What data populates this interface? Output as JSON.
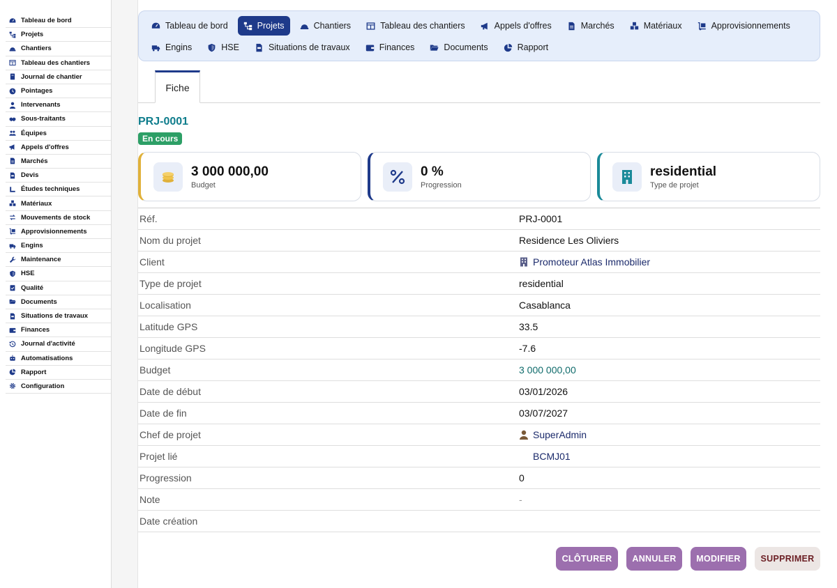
{
  "sidebar": {
    "items": [
      {
        "label": "Tableau de bord",
        "icon": "dashboard-icon"
      },
      {
        "label": "Projets",
        "icon": "sitemap-icon"
      },
      {
        "label": "Chantiers",
        "icon": "hard-hat-icon"
      },
      {
        "label": "Tableau des chantiers",
        "icon": "table-icon"
      },
      {
        "label": "Journal de chantier",
        "icon": "book-icon"
      },
      {
        "label": "Pointages",
        "icon": "clock-icon"
      },
      {
        "label": "Intervenants",
        "icon": "user-tie-icon"
      },
      {
        "label": "Sous-traitants",
        "icon": "handshake-icon"
      },
      {
        "label": "Équipes",
        "icon": "users-icon"
      },
      {
        "label": "Appels d'offres",
        "icon": "megaphone-icon"
      },
      {
        "label": "Marchés",
        "icon": "file-contract-icon"
      },
      {
        "label": "Devis",
        "icon": "file-invoice-icon"
      },
      {
        "label": "Études techniques",
        "icon": "ruler-icon"
      },
      {
        "label": "Matériaux",
        "icon": "cubes-icon"
      },
      {
        "label": "Mouvements de stock",
        "icon": "exchange-icon"
      },
      {
        "label": "Approvisionnements",
        "icon": "dolly-icon"
      },
      {
        "label": "Engins",
        "icon": "truck-icon"
      },
      {
        "label": "Maintenance",
        "icon": "wrench-icon"
      },
      {
        "label": "HSE",
        "icon": "shield-icon"
      },
      {
        "label": "Qualité",
        "icon": "clipboard-check-icon"
      },
      {
        "label": "Documents",
        "icon": "folder-open-icon"
      },
      {
        "label": "Situations de travaux",
        "icon": "file-invoice-icon"
      },
      {
        "label": "Finances",
        "icon": "wallet-icon"
      },
      {
        "label": "Journal d'activité",
        "icon": "history-icon"
      },
      {
        "label": "Automatisations",
        "icon": "robot-icon"
      },
      {
        "label": "Rapport",
        "icon": "chart-pie-icon"
      },
      {
        "label": "Configuration",
        "icon": "gear-icon"
      }
    ]
  },
  "topnav": {
    "row1": [
      {
        "label": "Tableau de bord",
        "icon": "dashboard-icon"
      },
      {
        "label": "Projets",
        "icon": "sitemap-icon",
        "active": true
      },
      {
        "label": "Chantiers",
        "icon": "hard-hat-icon"
      },
      {
        "label": "Tableau des chantiers",
        "icon": "table-icon"
      },
      {
        "label": "Appels d'offres",
        "icon": "megaphone-icon"
      },
      {
        "label": "Marchés",
        "icon": "file-contract-icon"
      },
      {
        "label": "Matériaux",
        "icon": "cubes-icon"
      },
      {
        "label": "Approvisionnements",
        "icon": "dolly-icon"
      }
    ],
    "row2": [
      {
        "label": "Engins",
        "icon": "truck-icon"
      },
      {
        "label": "HSE",
        "icon": "shield-icon"
      },
      {
        "label": "Situations de travaux",
        "icon": "file-invoice-icon"
      },
      {
        "label": "Finances",
        "icon": "wallet-icon"
      },
      {
        "label": "Documents",
        "icon": "folder-open-icon"
      },
      {
        "label": "Rapport",
        "icon": "chart-pie-icon"
      }
    ]
  },
  "tabs": {
    "fiche": "Fiche"
  },
  "header": {
    "ref": "PRJ-0001",
    "status": "En cours",
    "status_color": "#2d9f66"
  },
  "cards": {
    "budget": {
      "value": "3 000 000,00",
      "label": "Budget",
      "accent": "#e0b13a"
    },
    "progress": {
      "value": "0 %",
      "label": "Progression",
      "accent": "#1e3a8a"
    },
    "type": {
      "value": "residential",
      "label": "Type de projet",
      "accent": "#1a8a99"
    }
  },
  "details": [
    {
      "label": "Réf.",
      "value": "PRJ-0001"
    },
    {
      "label": "Nom du projet",
      "value": "Residence Les Oliviers"
    },
    {
      "label": "Client",
      "value": "Promoteur Atlas Immobilier",
      "kind": "link",
      "icon": "building-icon"
    },
    {
      "label": "Type de projet",
      "value": "residential"
    },
    {
      "label": "Localisation",
      "value": "Casablanca"
    },
    {
      "label": "Latitude GPS",
      "value": "33.5"
    },
    {
      "label": "Longitude GPS",
      "value": "-7.6"
    },
    {
      "label": "Budget",
      "value": "3 000 000,00",
      "kind": "money"
    },
    {
      "label": "Date de début",
      "value": "03/01/2026"
    },
    {
      "label": "Date de fin",
      "value": "03/07/2027"
    },
    {
      "label": "Chef de projet",
      "value": "SuperAdmin",
      "kind": "link",
      "icon": "user-icon"
    },
    {
      "label": "Projet lié",
      "value": "BCMJ01",
      "kind": "link",
      "icon": "sitemap-icon"
    },
    {
      "label": "Progression",
      "value": "0"
    },
    {
      "label": "Note",
      "value": "-",
      "kind": "muted"
    },
    {
      "label": "Date création",
      "value": ""
    }
  ],
  "actions": {
    "cloturer": "CLÔTURER",
    "annuler": "ANNULER",
    "modifier": "MODIFIER",
    "supprimer": "SUPPRIMER"
  },
  "colors": {
    "primary": "#1e3a8a",
    "action": "#9c6fae",
    "danger_bg": "#ece6e4",
    "danger_text": "#6b1f24"
  }
}
